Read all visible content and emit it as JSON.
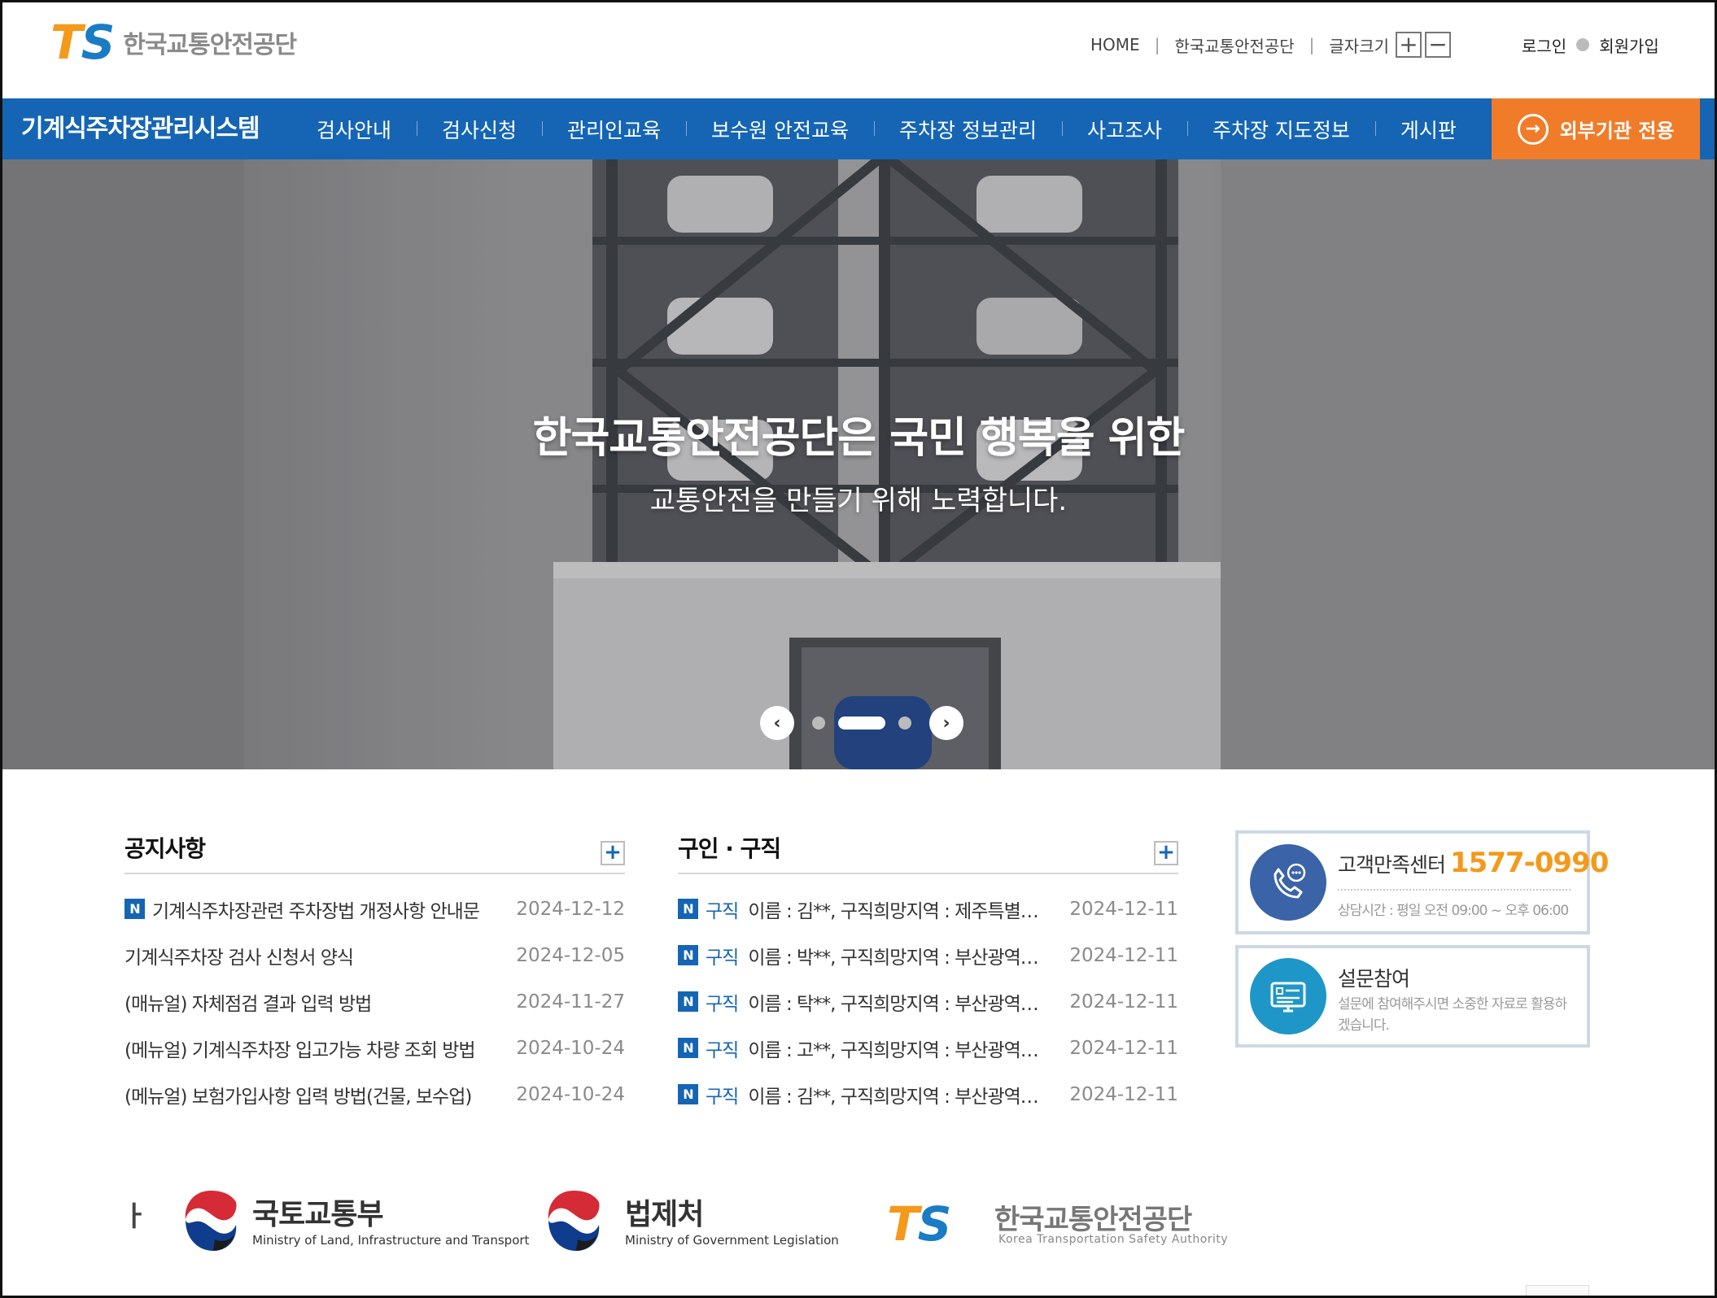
{
  "header": {
    "logo_ts_t": "T",
    "logo_ts_s": "S",
    "logo_name": "한국교통안전공단",
    "utility": {
      "home": "HOME",
      "org": "한국교통안전공단",
      "font_size_label": "글자크기",
      "font_increase": "+",
      "font_decrease": "−"
    },
    "login": "로그인",
    "signup": "회원가입"
  },
  "nav": {
    "system_title": "기계식주차장관리시스템",
    "items": [
      "검사안내",
      "검사신청",
      "관리인교육",
      "보수원 안전교육",
      "주차장 정보관리",
      "사고조사",
      "주차장 지도정보",
      "게시판"
    ],
    "external_label": "외부기관 전용",
    "external_arrow": "→"
  },
  "hero": {
    "title": "한국교통안전공단은 국민 행복을 위한",
    "subtitle": "교통안전을 만들기 위해 노력합니다.",
    "prev": "‹",
    "next": "›",
    "slide_count": 3,
    "active_slide": 2
  },
  "notice": {
    "title": "공지사항",
    "more": "+",
    "new_badge": "N",
    "items": [
      {
        "text": "기계식주차장관련 주차장법 개정사항 안내문",
        "date": "2024-12-12",
        "is_new": true
      },
      {
        "text": "기계식주차장 검사 신청서 양식",
        "date": "2024-12-05",
        "is_new": false
      },
      {
        "text": "(매뉴얼) 자체점검 결과 입력 방법",
        "date": "2024-11-27",
        "is_new": false
      },
      {
        "text": "(메뉴얼) 기계식주차장 입고가능 차량 조회 방법",
        "date": "2024-10-24",
        "is_new": false
      },
      {
        "text": "(메뉴얼) 보험가입사항 입력 방법(건물, 보수업)",
        "date": "2024-10-24",
        "is_new": false
      }
    ]
  },
  "jobs": {
    "title": "구인 · 구직",
    "more": "+",
    "new_badge": "N",
    "tag": "구직",
    "items": [
      {
        "text": "이름 : 김**, 구직희망지역 : 제주특별자치도 …",
        "date": "2024-12-11"
      },
      {
        "text": "이름 : 박**, 구직희망지역 : 부산광역시 북구 …",
        "date": "2024-12-11"
      },
      {
        "text": "이름 : 탁**, 구직희망지역 : 부산광역시 전체 …",
        "date": "2024-12-11"
      },
      {
        "text": "이름 : 고**, 구직희망지역 : 부산광역시 전체 …",
        "date": "2024-12-11"
      },
      {
        "text": "이름 : 김**, 구직희망지역 : 부산광역시 전체 …",
        "date": "2024-12-11"
      }
    ]
  },
  "customer_center": {
    "label": "고객만족센터",
    "phone": "1577-0990",
    "hours": "상담시간 : 평일 오전 09:00 ~ 오후 06:00"
  },
  "survey": {
    "title": "설문참여",
    "desc": "설문에 참여해주시면 소중한 자료로 활용하겠습니다."
  },
  "partners": {
    "cutoff": "ㅏ",
    "molit_name": "국토교통부",
    "molit_eng": "Ministry of Land, Infrastructure and Transport",
    "moleg_name": "법제처",
    "moleg_eng": "Ministry of Government Legislation",
    "ts_t": "T",
    "ts_s": "S",
    "ts_name": "한국교통안전공단",
    "ts_eng": "Korea Transportation Safety Authority"
  },
  "colors": {
    "primary_blue": "#1565b4",
    "accent_orange": "#f07c2a",
    "logo_orange": "#f39a1c"
  }
}
